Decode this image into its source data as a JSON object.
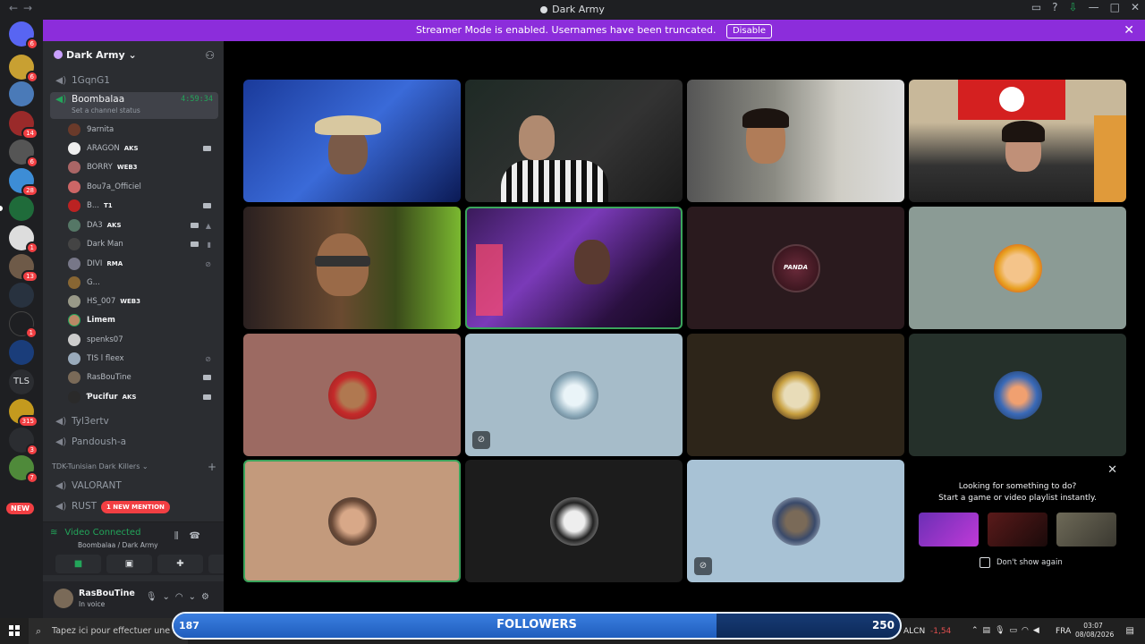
{
  "window": {
    "title": "Dark Army"
  },
  "banner": {
    "text": "Streamer Mode is enabled. Usernames have been truncated.",
    "button": "Disable"
  },
  "rail": {
    "badges": [
      "6",
      "6",
      "14",
      "6",
      "28",
      "1",
      "13",
      "1",
      "315",
      "3",
      "7"
    ],
    "tls": "TLS",
    "new": "NEW"
  },
  "server": {
    "name": "Dark Army"
  },
  "channels": {
    "first": "1GqnG1",
    "active": {
      "name": "Boombalaa",
      "time": "4:59:34",
      "status": "Set a channel status"
    },
    "after": [
      "Tyl3ertv",
      "Pandoush-a"
    ],
    "category": "TDK-Tunisian Dark Killers",
    "cat_channels": [
      "VALORANT",
      "RUST"
    ],
    "mention": "1 NEW MENTION"
  },
  "voice_users": [
    {
      "name": "9arnita",
      "tag": ""
    },
    {
      "name": "ARAGON",
      "tag": "AKS"
    },
    {
      "name": "BORRY",
      "tag": "WEB3"
    },
    {
      "name": "Bou7a_Officiel",
      "tag": ""
    },
    {
      "name": "B...",
      "tag": "T1"
    },
    {
      "name": "DA3",
      "tag": "AKS"
    },
    {
      "name": "Dark Man",
      "tag": ""
    },
    {
      "name": "DIVI",
      "tag": "RMA"
    },
    {
      "name": "G...",
      "tag": ""
    },
    {
      "name": "HS_007",
      "tag": "WEB3"
    },
    {
      "name": "Limem",
      "tag": ""
    },
    {
      "name": "spenks07",
      "tag": ""
    },
    {
      "name": "TIS l fleex",
      "tag": ""
    },
    {
      "name": "RasBouTine",
      "tag": ""
    },
    {
      "name": "Ƥucifur",
      "tag": "AKS"
    }
  ],
  "voice_panel": {
    "status": "Video Connected",
    "sub": "Boombalaa / Dark Army"
  },
  "user_panel": {
    "name": "RasBouTine",
    "status": "In voice"
  },
  "promo": {
    "line1": "Looking for something to do?",
    "line2": "Start a game or video playlist instantly.",
    "checkbox": "Don't show again",
    "game_colors": [
      "#6b2fb5",
      "#5a1a1a",
      "#6e6a58"
    ]
  },
  "tile_avatar_text": "PANDA",
  "followers": {
    "label": "FOLLOWERS",
    "current": "187",
    "target": "250",
    "progress": 0.748
  },
  "taskbar": {
    "search": "Tapez ici pour effectuer une re",
    "ticker": "ALCN",
    "price": "-1,54",
    "lang": "FRA",
    "time": "03:07",
    "date": "08/08/2026"
  }
}
